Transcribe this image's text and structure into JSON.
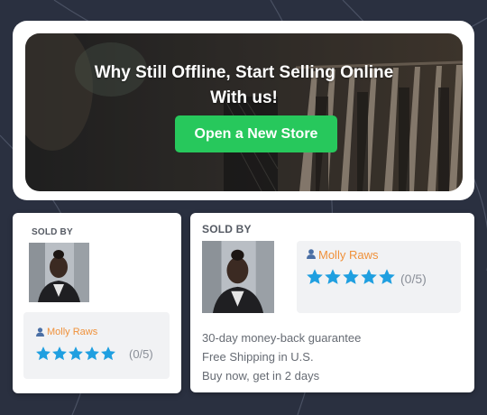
{
  "banner": {
    "title_line1": "Why Still Offline, Start Selling Online",
    "title_line2": "With us!",
    "cta_label": "Open a New Store"
  },
  "vendor_cards": [
    {
      "sold_by_label": "SOLD BY",
      "vendor_name": "Molly Raws",
      "rating_text": "(0/5)",
      "stars": 5
    },
    {
      "sold_by_label": "SOLD BY",
      "vendor_name": "Molly Raws",
      "rating_text": "(0/5)",
      "stars": 5,
      "perks": [
        "30-day money-back guarantee",
        "Free Shipping in U.S.",
        "Buy now, get in 2 days"
      ]
    }
  ],
  "colors": {
    "background": "#2a3040",
    "accent_green": "#27c85c",
    "vendor_name": "#f0913a",
    "star": "#1f9fe0"
  },
  "icons": [
    "user-icon",
    "star-icon"
  ]
}
